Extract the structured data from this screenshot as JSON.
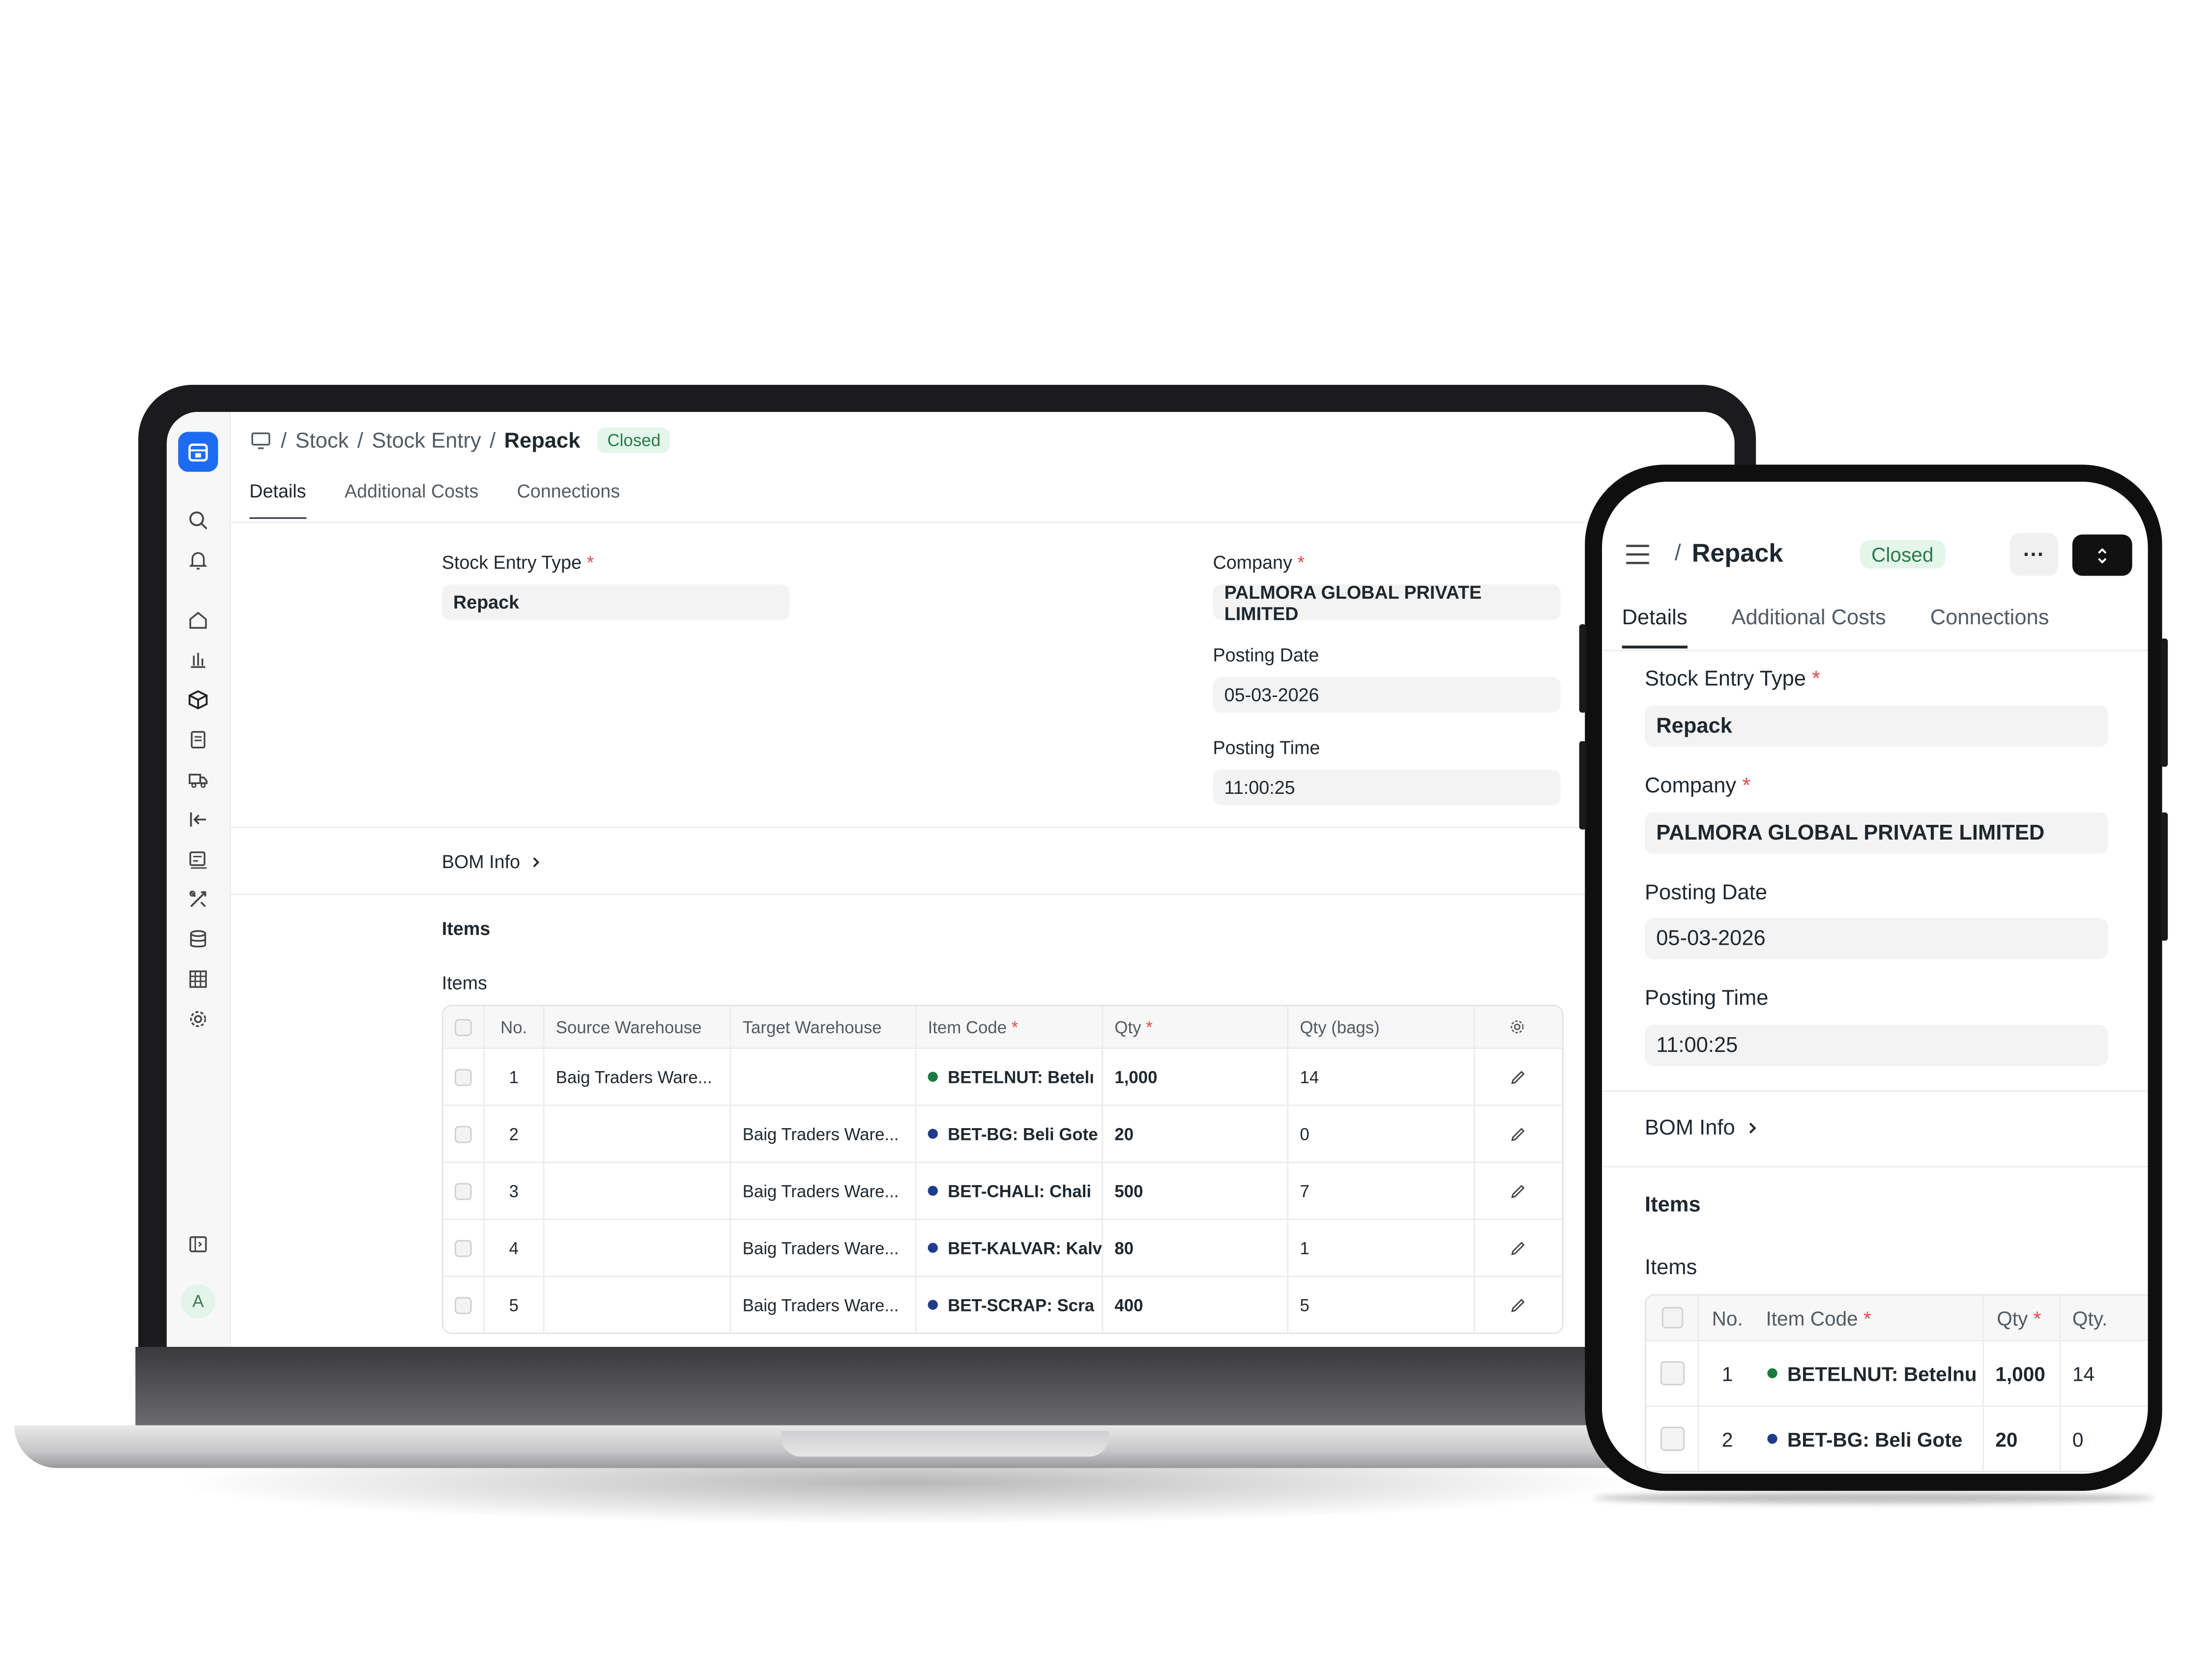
{
  "laptop": {
    "breadcrumb": {
      "sep": "/",
      "items": [
        "Stock",
        "Stock Entry"
      ],
      "current": "Repack",
      "status": "Closed"
    },
    "tabs": [
      "Details",
      "Additional Costs",
      "Connections"
    ],
    "fields": {
      "stock_entry_type": {
        "label": "Stock Entry Type",
        "required": "*",
        "value": "Repack"
      },
      "company": {
        "label": "Company",
        "required": "*",
        "value": "PALMORA GLOBAL PRIVATE LIMITED"
      },
      "posting_date": {
        "label": "Posting Date",
        "value": "05-03-2026"
      },
      "posting_time": {
        "label": "Posting Time",
        "value": "11:00:25"
      }
    },
    "bom_info": "BOM Info",
    "items_section": "Items",
    "items_label": "Items",
    "table": {
      "headers": {
        "no": "No.",
        "source": "Source Warehouse",
        "target": "Target Warehouse",
        "item_code": "Item Code",
        "qty": "Qty",
        "qty_bags": "Qty (bags)"
      },
      "rows": [
        {
          "no": "1",
          "source": "Baig Traders Ware...",
          "target": "",
          "item_code": "BETELNUT: Betelı",
          "qty": "1,000",
          "qty_bags": "14",
          "dot": "#1a7a3c"
        },
        {
          "no": "2",
          "source": "",
          "target": "Baig Traders Ware...",
          "item_code": "BET-BG: Beli Gote",
          "qty": "20",
          "qty_bags": "0",
          "dot": "#1f3c8a"
        },
        {
          "no": "3",
          "source": "",
          "target": "Baig Traders Ware...",
          "item_code": "BET-CHALI: Chali",
          "qty": "500",
          "qty_bags": "7",
          "dot": "#1f3c8a"
        },
        {
          "no": "4",
          "source": "",
          "target": "Baig Traders Ware...",
          "item_code": "BET-KALVAR: Kalv",
          "qty": "80",
          "qty_bags": "1",
          "dot": "#1f3c8a"
        },
        {
          "no": "5",
          "source": "",
          "target": "Baig Traders Ware...",
          "item_code": "BET-SCRAP: Scra",
          "qty": "400",
          "qty_bags": "5",
          "dot": "#1f3c8a"
        }
      ]
    },
    "avatar": "A"
  },
  "phone": {
    "title_sep": "/",
    "title": "Repack",
    "status": "Closed",
    "more": "···",
    "tabs": [
      "Details",
      "Additional Costs",
      "Connections"
    ],
    "fields": {
      "stock_entry_type": {
        "label": "Stock Entry Type",
        "required": "*",
        "value": "Repack"
      },
      "company": {
        "label": "Company",
        "required": "*",
        "value": "PALMORA GLOBAL PRIVATE LIMITED"
      },
      "posting_date": {
        "label": "Posting Date",
        "value": "05-03-2026"
      },
      "posting_time": {
        "label": "Posting Time",
        "value": "11:00:25"
      }
    },
    "bom_info": "BOM Info",
    "items_section": "Items",
    "items_label": "Items",
    "table": {
      "headers": {
        "no": "No.",
        "item_code": "Item Code",
        "qty": "Qty",
        "qty_bags": "Qty."
      },
      "rows": [
        {
          "no": "1",
          "item_code": "BETELNUT: Betelnu",
          "qty": "1,000",
          "qty_bags": "14",
          "dot": "#1a7a3c"
        },
        {
          "no": "2",
          "item_code": "BET-BG: Beli Gote",
          "qty": "20",
          "qty_bags": "0",
          "dot": "#1f3c8a"
        }
      ]
    }
  },
  "colors": {
    "accent": "#1d6bf2",
    "status_bg": "#e4f5ea",
    "status_text": "#2b7a4a",
    "required": "#e24c4c"
  }
}
